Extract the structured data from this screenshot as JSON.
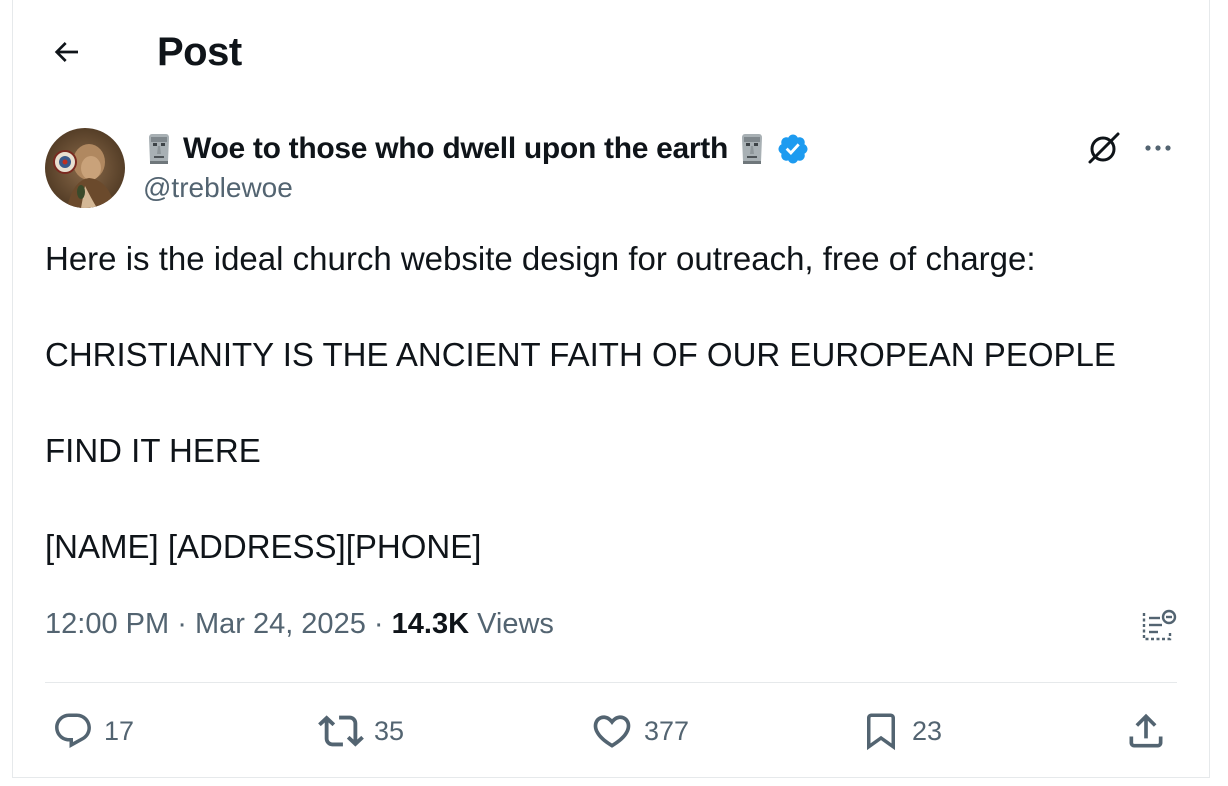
{
  "header": {
    "title": "Post",
    "back_icon": "arrow-left-icon"
  },
  "author": {
    "display_name": "Woe to those who dwell upon the earth",
    "handle": "@treblewoe",
    "verified": true,
    "name_emoji": "moai",
    "verified_color": "#1d9bf0"
  },
  "tweet": {
    "lines": [
      "Here is the ideal church website design for outreach, free of charge:",
      "CHRISTIANITY IS THE ANCIENT FAITH OF OUR EUROPEAN PEOPLE",
      "FIND IT HERE",
      "[NAME] [ADDRESS][PHONE]"
    ]
  },
  "meta": {
    "time": "12:00 PM",
    "separator": "·",
    "date": "Mar 24, 2025",
    "views_count": "14.3K",
    "views_label": "Views"
  },
  "actions": {
    "replies": "17",
    "retweets": "35",
    "likes": "377",
    "bookmarks": "23"
  },
  "colors": {
    "text_primary": "#0f1419",
    "text_secondary": "#536471",
    "divider": "#e6e9eb",
    "accent": "#1d9bf0"
  }
}
